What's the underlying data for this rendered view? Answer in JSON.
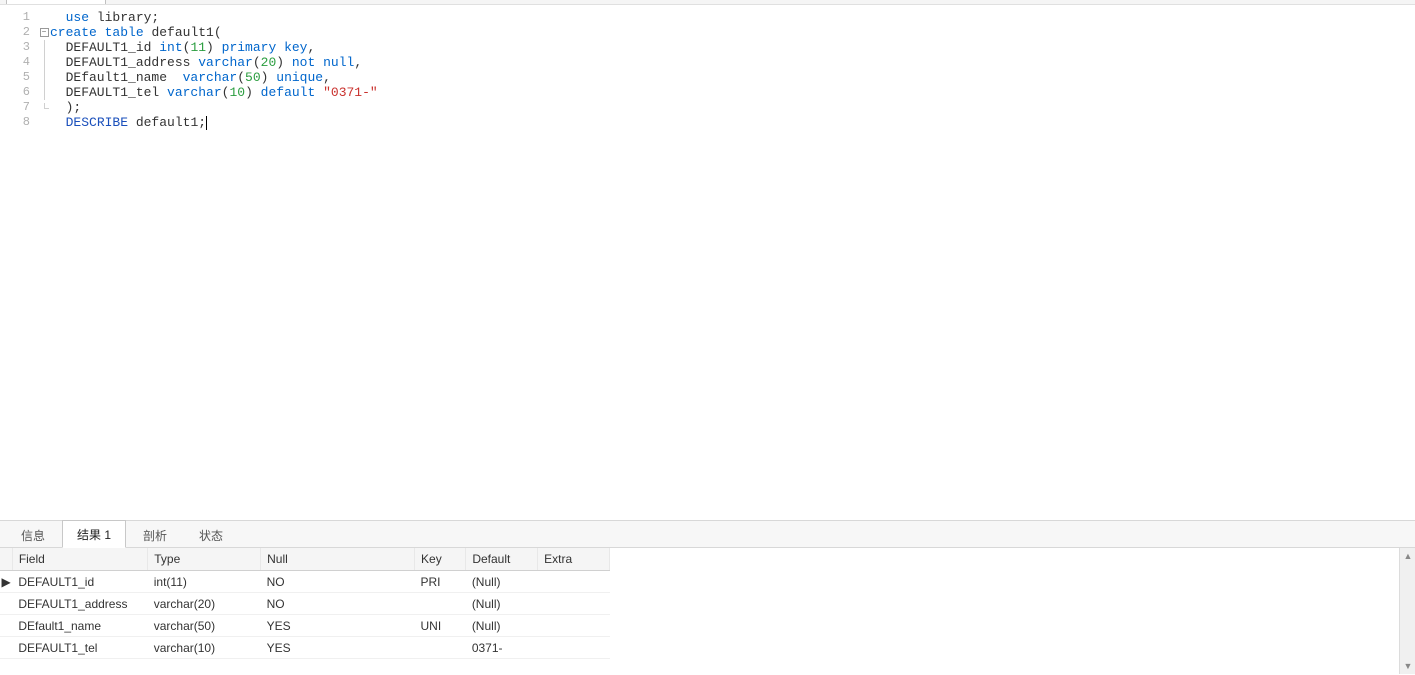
{
  "editor": {
    "lines": [
      {
        "num": "1",
        "fold": "",
        "tokens": [
          {
            "t": "  ",
            "c": "txt"
          },
          {
            "t": "use",
            "c": "kw-blue"
          },
          {
            "t": " library;",
            "c": "txt"
          }
        ]
      },
      {
        "num": "2",
        "fold": "open",
        "tokens": [
          {
            "t": "create",
            "c": "kw-blue"
          },
          {
            "t": " ",
            "c": "txt"
          },
          {
            "t": "table",
            "c": "kw-blue"
          },
          {
            "t": " default1(",
            "c": "txt"
          }
        ]
      },
      {
        "num": "3",
        "fold": "line",
        "tokens": [
          {
            "t": "  DEFAULT1_id ",
            "c": "txt"
          },
          {
            "t": "int",
            "c": "kw-blue"
          },
          {
            "t": "(",
            "c": "txt"
          },
          {
            "t": "11",
            "c": "num-green"
          },
          {
            "t": ") ",
            "c": "txt"
          },
          {
            "t": "primary",
            "c": "kw-blue"
          },
          {
            "t": " ",
            "c": "txt"
          },
          {
            "t": "key",
            "c": "kw-blue"
          },
          {
            "t": ",",
            "c": "txt"
          }
        ]
      },
      {
        "num": "4",
        "fold": "line",
        "tokens": [
          {
            "t": "  DEFAULT1_address ",
            "c": "txt"
          },
          {
            "t": "varchar",
            "c": "kw-blue"
          },
          {
            "t": "(",
            "c": "txt"
          },
          {
            "t": "20",
            "c": "num-green"
          },
          {
            "t": ") ",
            "c": "txt"
          },
          {
            "t": "not",
            "c": "kw-blue"
          },
          {
            "t": " ",
            "c": "txt"
          },
          {
            "t": "null",
            "c": "kw-blue"
          },
          {
            "t": ",",
            "c": "txt"
          }
        ]
      },
      {
        "num": "5",
        "fold": "line",
        "tokens": [
          {
            "t": "  DEfault1_name  ",
            "c": "txt"
          },
          {
            "t": "varchar",
            "c": "kw-blue"
          },
          {
            "t": "(",
            "c": "txt"
          },
          {
            "t": "50",
            "c": "num-green"
          },
          {
            "t": ") ",
            "c": "txt"
          },
          {
            "t": "unique",
            "c": "kw-blue"
          },
          {
            "t": ",",
            "c": "txt"
          }
        ]
      },
      {
        "num": "6",
        "fold": "line",
        "tokens": [
          {
            "t": "  DEFAULT1_tel ",
            "c": "txt"
          },
          {
            "t": "varchar",
            "c": "kw-blue"
          },
          {
            "t": "(",
            "c": "txt"
          },
          {
            "t": "10",
            "c": "num-green"
          },
          {
            "t": ") ",
            "c": "txt"
          },
          {
            "t": "default",
            "c": "kw-blue"
          },
          {
            "t": " ",
            "c": "txt"
          },
          {
            "t": "\"0371-\"",
            "c": "str-red"
          }
        ]
      },
      {
        "num": "7",
        "fold": "end",
        "tokens": [
          {
            "t": "  );",
            "c": "txt"
          }
        ]
      },
      {
        "num": "8",
        "fold": "",
        "tokens": [
          {
            "t": "  ",
            "c": "txt"
          },
          {
            "t": "DESCRIBE",
            "c": "kw-darkblue"
          },
          {
            "t": " default1;",
            "c": "txt"
          }
        ],
        "cursor": true
      }
    ]
  },
  "tabs": {
    "info": "信息",
    "result1": "结果 1",
    "profile": "剖析",
    "status": "状态"
  },
  "grid": {
    "headers": {
      "field": "Field",
      "type": "Type",
      "null": "Null",
      "key": "Key",
      "default": "Default",
      "extra": "Extra"
    },
    "null_text": "(Null)",
    "rows": [
      {
        "current": true,
        "field": "DEFAULT1_id",
        "type": "int(11)",
        "null": "NO",
        "key": "PRI",
        "default": null,
        "extra": ""
      },
      {
        "current": false,
        "field": "DEFAULT1_address",
        "type": "varchar(20)",
        "null": "NO",
        "key": "",
        "default": null,
        "extra": ""
      },
      {
        "current": false,
        "field": "DEfault1_name",
        "type": "varchar(50)",
        "null": "YES",
        "key": "UNI",
        "default": null,
        "extra": ""
      },
      {
        "current": false,
        "field": "DEFAULT1_tel",
        "type": "varchar(10)",
        "null": "YES",
        "key": "",
        "default": "0371-",
        "extra": ""
      }
    ]
  }
}
